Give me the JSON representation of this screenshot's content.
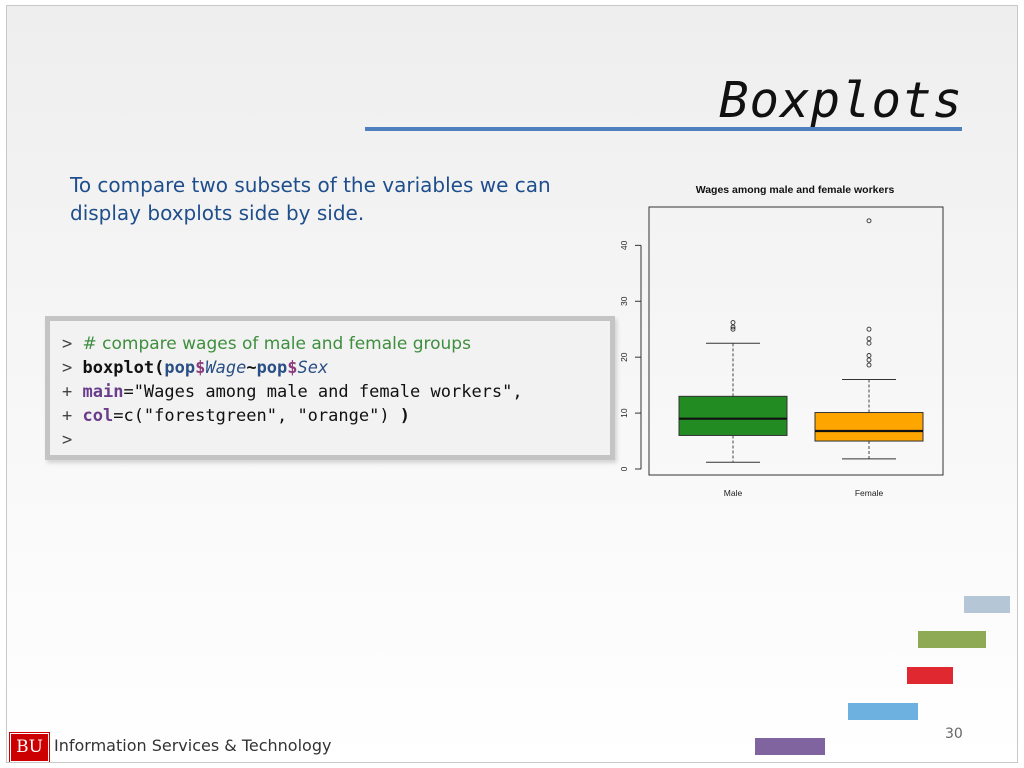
{
  "slide": {
    "title": "Boxplots",
    "intro": "To compare two subsets of the variables we can display boxplots side by side.",
    "page_number": "30"
  },
  "code": {
    "line1_prompt": ">",
    "line1_comment": "# compare wages of male and female groups",
    "line2_prompt": ">",
    "line2_fn": "boxplot(",
    "line2_obj1": "pop",
    "line2_dollar1": "$",
    "line2_field1": "Wage",
    "line2_tilde": "~",
    "line2_obj2": "pop",
    "line2_dollar2": "$",
    "line2_field2": "Sex",
    "line3_prompt": "+",
    "line3_arg": "main",
    "line3_rest": "=\"Wages among male and female workers\",",
    "line4_prompt": "+",
    "line4_arg": "col",
    "line4_rest": "=c(\"forestgreen\", \"orange\") ",
    "line4_close": ")",
    "line5_prompt": ">"
  },
  "chart_data": {
    "type": "boxplot",
    "title": "Wages among male and female workers",
    "xlabel": "",
    "ylabel": "",
    "ylim": [
      0,
      45
    ],
    "yticks": [
      0,
      10,
      20,
      30,
      40
    ],
    "groups": [
      {
        "name": "Male",
        "color": "#228b22",
        "min": 1.2,
        "q1": 6,
        "median": 9,
        "q3": 13,
        "max": 22.5,
        "outliers": [
          25,
          25.4,
          26.2
        ]
      },
      {
        "name": "Female",
        "color": "#ffa500",
        "min": 1.8,
        "q1": 5,
        "median": 6.8,
        "q3": 10.1,
        "max": 16,
        "outliers": [
          18.6,
          19.5,
          20.3,
          22.5,
          23.3,
          25,
          44.4
        ]
      }
    ]
  },
  "footer": {
    "logo": "BU",
    "text": "Information Services & Technology"
  },
  "decorations": {
    "colors": [
      "#b5c7d6",
      "#8faa55",
      "#e02830",
      "#6cb1e0",
      "#8064a0"
    ]
  }
}
